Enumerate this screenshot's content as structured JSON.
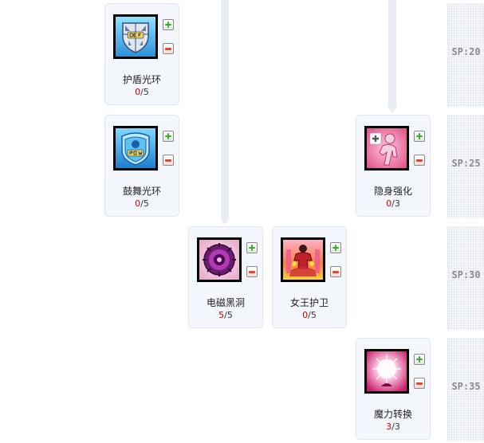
{
  "skills": [
    {
      "name": "护盾光环",
      "current": "0",
      "max": "5",
      "icon": "def-shield-icon"
    },
    {
      "name": "鼓舞光环",
      "current": "0",
      "max": "5",
      "icon": "pow-shield-icon"
    },
    {
      "name": "隐身强化",
      "current": "0",
      "max": "3",
      "icon": "stealth-figure-icon"
    },
    {
      "name": "电磁黑洞",
      "current": "5",
      "max": "5",
      "icon": "black-hole-icon"
    },
    {
      "name": "女王护卫",
      "current": "0",
      "max": "5",
      "icon": "queen-guard-icon"
    },
    {
      "name": "魔力转换",
      "current": "3",
      "max": "3",
      "icon": "mana-burst-icon"
    }
  ],
  "sp_tiers": [
    "SP:20",
    "SP:25",
    "SP:30",
    "SP:35"
  ],
  "colors": {
    "current_level": "#cc0000",
    "plus": "#3cae2c",
    "minus": "#e0492a",
    "connector": "#e8edf4"
  }
}
